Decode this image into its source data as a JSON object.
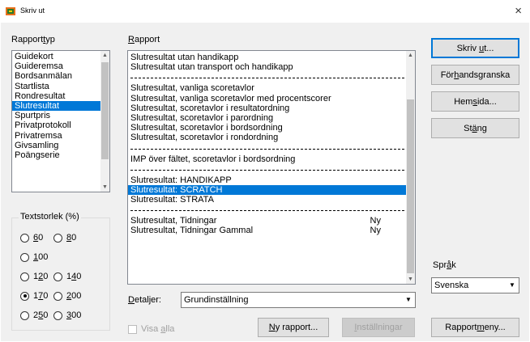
{
  "window": {
    "title": "Skriv ut",
    "close_glyph": "×"
  },
  "labels": {
    "rapporttyp_pre": "Rapport",
    "rapporttyp_ul": "t",
    "rapporttyp_post": "yp",
    "rapport_ul": "R",
    "rapport_post": "apport",
    "detaljer_ul": "D",
    "detaljer_post": "etaljer:",
    "sprak_pre": "Spr",
    "sprak_ul": "å",
    "sprak_post": "k"
  },
  "report_types": {
    "items": [
      "Guidekort",
      "Guideremsa",
      "Bordsanmälan",
      "Startlista",
      "Rondresultat",
      "Slutresultat",
      "Spurtpris",
      "Privatprotokoll",
      "Privatremsa",
      "Givsamling",
      "Poängserie"
    ],
    "selected_index": 5
  },
  "reports": {
    "rows": [
      {
        "type": "item",
        "text": "Slutresultat utan handikapp"
      },
      {
        "type": "item",
        "text": "Slutresultat utan transport och handikapp"
      },
      {
        "type": "sep"
      },
      {
        "type": "item",
        "text": "Slutresultat, vanliga scoretavlor"
      },
      {
        "type": "item",
        "text": "Slutresultat, vanliga scoretavlor med procentscorer"
      },
      {
        "type": "item",
        "text": "Slutresultat, scoretavlor i resultatordning"
      },
      {
        "type": "item",
        "text": "Slutresultat, scoretavlor i parordning"
      },
      {
        "type": "item",
        "text": "Slutresultat, scoretavlor i bordsordning"
      },
      {
        "type": "item",
        "text": "Slutresultat, scoretavlor i rondordning"
      },
      {
        "type": "sep"
      },
      {
        "type": "item",
        "text": "IMP över fältet, scoretavlor i bordsordning"
      },
      {
        "type": "sep"
      },
      {
        "type": "item",
        "text": "Slutresultat: HANDIKAPP"
      },
      {
        "type": "item",
        "text": "Slutresultat: SCRATCH",
        "selected": true
      },
      {
        "type": "item",
        "text": "Slutresultat: STRATA"
      },
      {
        "type": "sep"
      },
      {
        "type": "item",
        "text": "Slutresultat, Tidningar",
        "badge": "Ny"
      },
      {
        "type": "item",
        "text": "Slutresultat, Tidningar Gammal",
        "badge": "Ny"
      }
    ]
  },
  "details": {
    "value": "Grundinställning"
  },
  "font_size_group": {
    "legend": "Textstorlek (%)",
    "options": [
      {
        "pre": "",
        "ul": "6",
        "post": "0"
      },
      {
        "pre": "",
        "ul": "8",
        "post": "0"
      },
      {
        "pre": "",
        "ul": "1",
        "post": "00"
      },
      {
        "pre": "1",
        "ul": "2",
        "post": "0"
      },
      {
        "pre": "1",
        "ul": "4",
        "post": "0"
      },
      {
        "pre": "1",
        "ul": "7",
        "post": "0"
      },
      {
        "pre": "",
        "ul": "2",
        "post": "00"
      },
      {
        "pre": "2",
        "ul": "5",
        "post": "0"
      },
      {
        "pre": "",
        "ul": "3",
        "post": "00"
      }
    ],
    "selected_value": "170"
  },
  "show_all": {
    "pre": "Visa ",
    "ul": "a",
    "post": "lla",
    "checked": false
  },
  "buttons": {
    "print": {
      "pre": "Skriv ",
      "ul": "u",
      "post": "t..."
    },
    "preview": {
      "pre": "För",
      "ul": "h",
      "post": "andsgranska"
    },
    "homepage": {
      "pre": "Hem",
      "ul": "s",
      "post": "ida..."
    },
    "close": {
      "pre": "St",
      "ul": "ä",
      "post": "ng"
    },
    "new_report": {
      "pre": "",
      "ul": "N",
      "post": "y rapport..."
    },
    "settings": {
      "pre": "",
      "ul": "I",
      "post": "nställningar"
    },
    "report_menu": {
      "pre": "Rapport",
      "ul": "m",
      "post": "eny..."
    }
  },
  "language": {
    "value": "Svenska"
  },
  "colors": {
    "selection": "#0078d7",
    "dialog_bg": "#f0f0f0",
    "app_icon": "#e8701a"
  }
}
